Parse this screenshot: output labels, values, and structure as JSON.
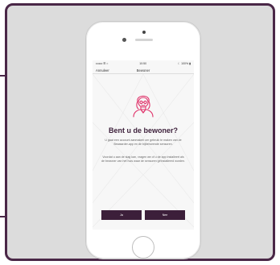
{
  "status_bar": {
    "carrier": "••ooo ☰ ≈",
    "time": "10:50",
    "battery": "☾ 100% ▮"
  },
  "nav": {
    "cancel_label": "Annuleer",
    "title": "Bewoner"
  },
  "content": {
    "heading": "Bent u de bewoner?",
    "paragraph_1": "U gaat een account aanmaken om gebruik te maken van de Bewaarder-app en de bijbehorende sensoren.",
    "paragraph_2": "Voordat u aan de slag kan, vragen we of u de app installeert als de bewoner van het huis waar de sensoren geïnstalleerd worden."
  },
  "buttons": {
    "yes_label": "Ja",
    "no_label": "Nee"
  },
  "colors": {
    "frame_border": "#4a2747",
    "primary": "#3c1f3a",
    "avatar_accent": "#e0346b"
  }
}
